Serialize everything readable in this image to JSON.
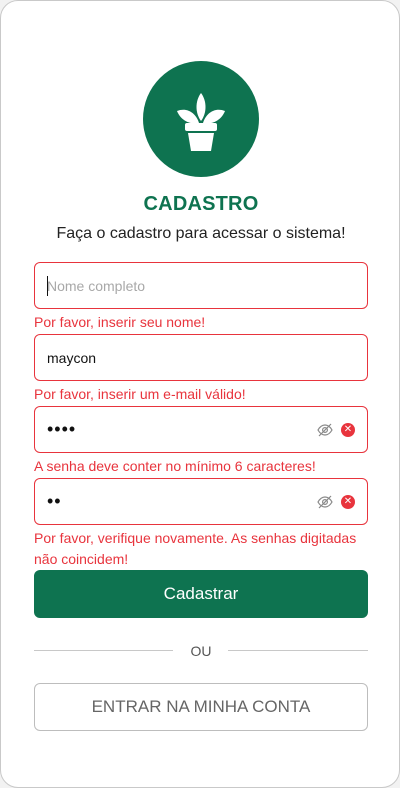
{
  "brand": {
    "color": "#0e7350",
    "error_color": "#e8343d",
    "logo_icon": "plant-pot-icon"
  },
  "header": {
    "title": "CADASTRO",
    "subtitle": "Faça o cadastro para acessar o sistema!"
  },
  "form": {
    "name": {
      "placeholder": "Nome completo",
      "value": "",
      "error": "Por favor, inserir seu nome!"
    },
    "email": {
      "value": "maycon",
      "error": "Por favor, inserir um e-mail válido!"
    },
    "password": {
      "masked": "••••",
      "error": "A senha deve conter no mínimo 6 caracteres!"
    },
    "confirm": {
      "masked": "••",
      "error": "Por favor, verifique novamente. As senhas digitadas não coincidem!"
    },
    "submit_label": "Cadastrar"
  },
  "divider_label": "OU",
  "login_label": "ENTRAR NA MINHA CONTA"
}
